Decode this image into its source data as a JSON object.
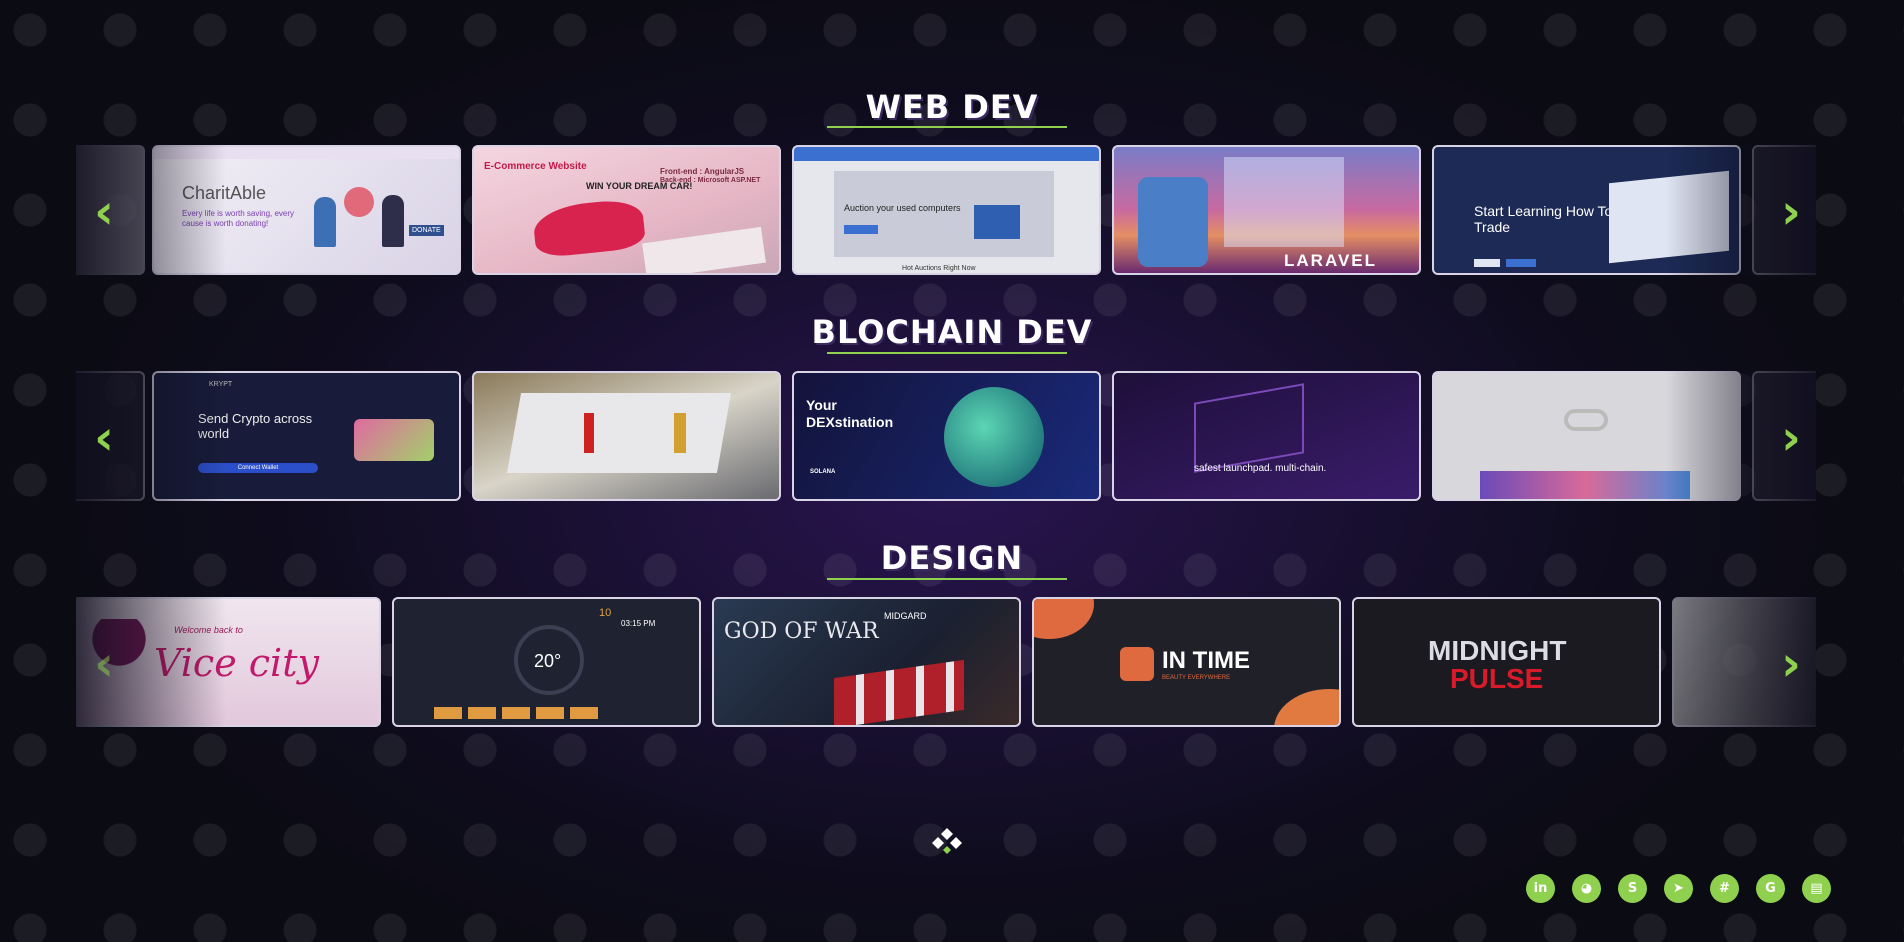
{
  "sections": [
    {
      "title": "WEB DEV",
      "cards": [
        {
          "title": "CharitAble",
          "line1": "Every life is worth saving, every",
          "line2": "cause is worth donating!",
          "extra": "DONATE"
        },
        {
          "title": "E-Commerce Website",
          "line1": "WIN YOUR DREAM CAR!",
          "line2": "Front-end : AngularJS",
          "extra": "Back-end : Microsoft ASP.NET"
        },
        {
          "title": "Auction your used computers",
          "line1": "Hot Auctions Right Now",
          "line2": "",
          "extra": ""
        },
        {
          "title": "LARAVEL",
          "line1": "",
          "line2": "",
          "extra": ""
        },
        {
          "title": "Start Learning How To Trade",
          "line1": "",
          "line2": "",
          "extra": ""
        }
      ]
    },
    {
      "title": "BLOCHAIN DEV",
      "cards": [
        {
          "title": "Send Crypto across world",
          "line1": "KRYPT",
          "line2": "Connect Wallet",
          "extra": ""
        },
        {
          "title": "",
          "line1": "",
          "line2": "",
          "extra": ""
        },
        {
          "title": "Your DEXstination",
          "line1": "SOLANA",
          "line2": "",
          "extra": ""
        },
        {
          "title": "safest launchpad. multi-chain.",
          "line1": "",
          "line2": "",
          "extra": ""
        },
        {
          "title": "",
          "line1": "",
          "line2": "",
          "extra": ""
        }
      ]
    },
    {
      "title": "DESIGN",
      "cards": [
        {
          "title": "Vice city",
          "line1": "Welcome back to",
          "line2": "",
          "extra": ""
        },
        {
          "title": "20°",
          "line1": "03:15 PM",
          "line2": "10",
          "extra": ""
        },
        {
          "title": "GOD OF WAR",
          "line1": "MIDGARD",
          "line2": "",
          "extra": ""
        },
        {
          "title": "IN TIME",
          "line1": "BEAUTY EVERYWHERE",
          "line2": "",
          "extra": ""
        },
        {
          "title": "MIDNIGHT",
          "line1": "PULSE",
          "line2": "",
          "extra": ""
        }
      ]
    }
  ],
  "arrows": {
    "prev": "‹",
    "next": "›"
  },
  "socials": [
    {
      "icon": "linkedin-icon",
      "glyph": "in"
    },
    {
      "icon": "github-icon",
      "glyph": "◕"
    },
    {
      "icon": "skype-icon",
      "glyph": "S"
    },
    {
      "icon": "telegram-icon",
      "glyph": "➤"
    },
    {
      "icon": "slack-icon",
      "glyph": "#"
    },
    {
      "icon": "google-icon",
      "glyph": "G"
    },
    {
      "icon": "resume-book-icon",
      "glyph": "▤"
    }
  ],
  "colors": {
    "accent": "#8fd14f",
    "background": "#0e0c1c",
    "card_border": "#d8d4e6"
  }
}
